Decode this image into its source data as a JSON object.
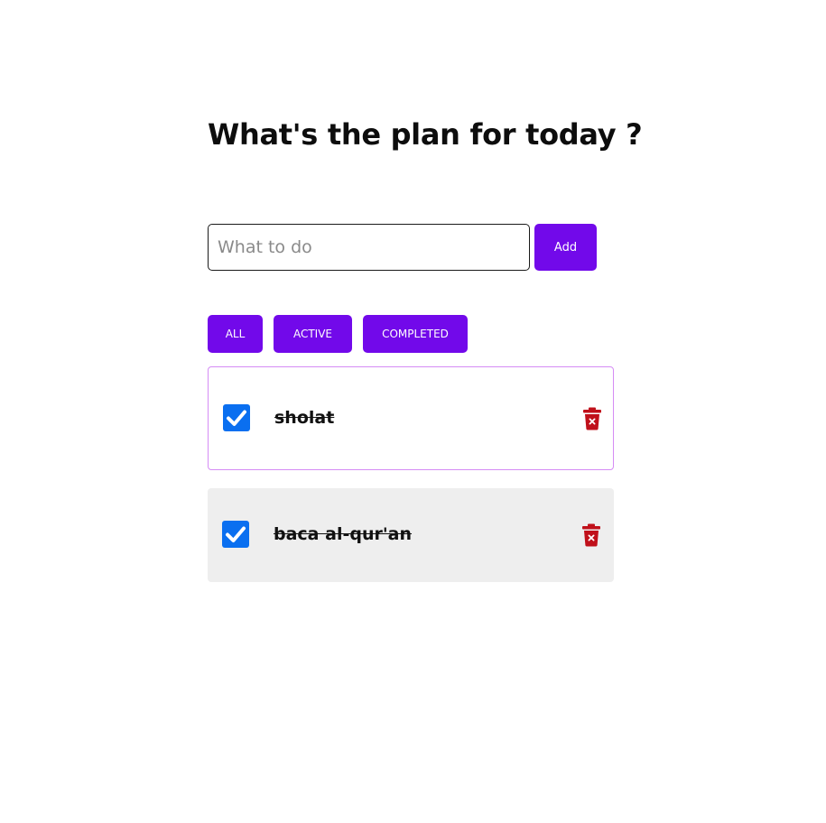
{
  "header": {
    "title": "What's the plan for today ?"
  },
  "form": {
    "placeholder": "What to do",
    "value": "",
    "add_label": "Add"
  },
  "filters": {
    "all": "ALL",
    "active": "ACTIVE",
    "completed": "COMPLETED"
  },
  "todos": [
    {
      "text": "sholat",
      "completed": true
    },
    {
      "text": "baca al-qur'an",
      "completed": true
    }
  ],
  "colors": {
    "accent": "#7209ea",
    "checkbox": "#0a6ff0",
    "delete": "#c0101a",
    "item_border": "#d58cf5",
    "item_alt_bg": "#eeeeee"
  },
  "icons": {
    "check": "check-icon",
    "delete": "trash-icon"
  }
}
